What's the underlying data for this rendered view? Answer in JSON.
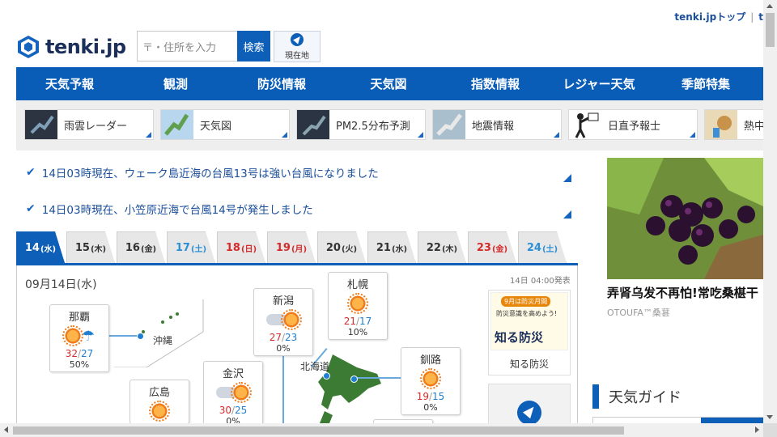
{
  "header": {
    "logo_text": "tenki.jp",
    "top_link": "tenki.jpトップ",
    "top_link_sep": "|",
    "top_link_more": "t",
    "search_placeholder": "〒・住所を入力",
    "search_button": "検索",
    "location_button": "現在地"
  },
  "nav": [
    "天気予報",
    "観測",
    "防災情報",
    "天気図",
    "指数情報",
    "レジャー天気",
    "季節特集"
  ],
  "shortcuts": [
    "雨雲レーダー",
    "天気図",
    "PM2.5分布予測",
    "地震情報",
    "日直予報士",
    "熱中"
  ],
  "news": [
    "14日03時現在、ウェーク島近海の台風13号は強い台風になりました",
    "14日03時現在、小笠原近海で台風14号が発生しました"
  ],
  "tabs": [
    {
      "day": "14",
      "wd": "(水)",
      "type": "active"
    },
    {
      "day": "15",
      "wd": "(木)",
      "type": ""
    },
    {
      "day": "16",
      "wd": "(金)",
      "type": ""
    },
    {
      "day": "17",
      "wd": "(土)",
      "type": "sat"
    },
    {
      "day": "18",
      "wd": "(日)",
      "type": "hol"
    },
    {
      "day": "19",
      "wd": "(月)",
      "type": "hol"
    },
    {
      "day": "20",
      "wd": "(火)",
      "type": ""
    },
    {
      "day": "21",
      "wd": "(水)",
      "type": ""
    },
    {
      "day": "22",
      "wd": "(木)",
      "type": ""
    },
    {
      "day": "23",
      "wd": "(金)",
      "type": "hol"
    },
    {
      "day": "24",
      "wd": "(土)",
      "type": "sat"
    }
  ],
  "forecast": {
    "date": "09月14日(水)",
    "issued": "14日 04:00発表",
    "cities": {
      "naha": {
        "name": "那覇",
        "hi": "32",
        "lo": "27",
        "pop": "50%",
        "icon": "sun-umbrella-icon"
      },
      "niigata": {
        "name": "新潟",
        "hi": "27",
        "lo": "23",
        "pop": "0%",
        "icon": "cloud-sun-icon"
      },
      "sapporo": {
        "name": "札幌",
        "hi": "21",
        "lo": "17",
        "pop": "10%",
        "icon": "sun-icon"
      },
      "kanazawa": {
        "name": "金沢",
        "hi": "30",
        "lo": "25",
        "pop": "0%",
        "icon": "cloud-sun-icon"
      },
      "kushiro": {
        "name": "釧路",
        "hi": "19",
        "lo": "15",
        "pop": "0%",
        "icon": "sun-icon"
      },
      "hiroshima": {
        "name": "広島",
        "icon": "sun-icon"
      }
    },
    "labels": {
      "okinawa": "沖縄",
      "hokkaido": "北海道"
    },
    "bousai": {
      "badge": "9月は防災月間",
      "line": "防災意識を高めよう!",
      "title": "知る防災",
      "caption": "知る防災"
    }
  },
  "ad": {
    "title": "弄肾乌发不再怕!常吃桑椹干",
    "source": "OTOUFA™桑葚"
  },
  "guide": {
    "title": "天気ガイド"
  },
  "colors": {
    "brand": "#0a5db7",
    "high": "#d62b2b",
    "low": "#1f7fd0",
    "saturday": "#2b8fd6"
  }
}
